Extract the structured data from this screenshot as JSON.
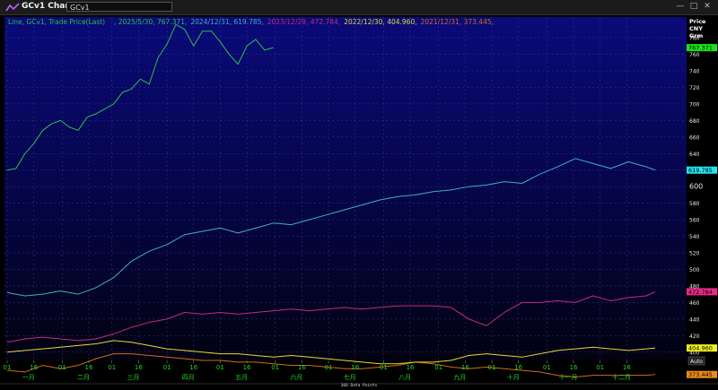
{
  "window": {
    "title": "GCv1 Chart",
    "ticker": "GCv1",
    "controls": [
      "—",
      "□",
      "✕"
    ]
  },
  "chart_data": {
    "type": "line",
    "title": "Line, GCv1, Trade Price(Last)",
    "y_axis_header": [
      "Price",
      "CNY",
      "Grm"
    ],
    "ylim": [
      390,
      805
    ],
    "yticks": [
      400,
      420,
      440,
      460,
      480,
      500,
      520,
      540,
      560,
      580,
      600,
      620,
      640,
      660,
      680,
      700,
      720,
      740,
      760,
      780
    ],
    "x_ticks": [
      "01",
      "16",
      "01",
      "16",
      "01",
      "16",
      "01",
      "16",
      "01",
      "16",
      "01",
      "16",
      "01",
      "16",
      "01",
      "16",
      "01",
      "16",
      "01",
      "16",
      "01",
      "16",
      "01",
      "16"
    ],
    "months": [
      "一月",
      "二月",
      "三月",
      "四月",
      "五月",
      "六月",
      "七月",
      "八月",
      "九月",
      "十月",
      "十一月",
      "十二月"
    ],
    "footer": "366 Data Points",
    "auto_label": "Auto",
    "series": [
      {
        "name": "2025/5/30",
        "last_label": "767.371",
        "color": "#2dbf4a",
        "badge_color": "#19e619",
        "x": [
          0,
          5,
          10,
          15,
          20,
          25,
          30,
          35,
          40,
          45,
          50,
          55,
          60,
          65,
          70,
          75,
          80,
          85,
          90,
          95,
          100,
          105,
          110,
          115,
          120,
          125,
          130,
          135,
          140,
          145,
          150
        ],
        "values": [
          620,
          622,
          640,
          652,
          668,
          676,
          680,
          672,
          668,
          684,
          688,
          694,
          700,
          714,
          718,
          730,
          724,
          756,
          772,
          796,
          790,
          770,
          788,
          788,
          775,
          760,
          748,
          770,
          778,
          765,
          768
        ]
      },
      {
        "name": "2024/12/31",
        "last_label": "619.785",
        "color": "#3db0bf",
        "badge_color": "#22e5f0",
        "x": [
          0,
          10,
          20,
          30,
          40,
          50,
          60,
          70,
          80,
          90,
          100,
          110,
          120,
          130,
          140,
          150,
          160,
          170,
          180,
          190,
          200,
          210,
          220,
          230,
          240,
          250,
          260,
          270,
          280,
          290,
          300,
          310,
          320,
          330,
          340,
          350,
          360,
          365
        ],
        "values": [
          472,
          468,
          470,
          474,
          470,
          478,
          490,
          510,
          522,
          530,
          542,
          546,
          550,
          544,
          550,
          556,
          554,
          560,
          566,
          572,
          578,
          584,
          588,
          590,
          594,
          596,
          600,
          602,
          606,
          604,
          615,
          624,
          634,
          628,
          622,
          630,
          624,
          620
        ]
      },
      {
        "name": "2023/12/29",
        "last_label": "472.784",
        "color": "#c82a78",
        "badge_color": "#ea2a8a",
        "x": [
          0,
          10,
          20,
          30,
          40,
          50,
          60,
          70,
          80,
          90,
          100,
          110,
          120,
          130,
          140,
          150,
          160,
          170,
          180,
          190,
          200,
          210,
          220,
          230,
          240,
          250,
          260,
          270,
          280,
          290,
          300,
          310,
          320,
          330,
          340,
          350,
          360,
          365
        ],
        "values": [
          412,
          416,
          418,
          416,
          414,
          416,
          422,
          430,
          436,
          440,
          448,
          446,
          448,
          446,
          448,
          450,
          452,
          450,
          452,
          454,
          452,
          454,
          456,
          456,
          456,
          454,
          440,
          432,
          448,
          460,
          460,
          462,
          460,
          468,
          462,
          466,
          468,
          473
        ]
      },
      {
        "name": "2022/12/30",
        "last_label": "404.960",
        "color": "#e6d836",
        "badge_color": "#f0f020",
        "x": [
          0,
          10,
          20,
          30,
          40,
          50,
          60,
          70,
          80,
          90,
          100,
          110,
          120,
          130,
          140,
          150,
          160,
          170,
          180,
          190,
          200,
          210,
          220,
          230,
          240,
          250,
          260,
          270,
          280,
          290,
          300,
          310,
          320,
          330,
          340,
          350,
          360,
          365
        ],
        "values": [
          400,
          402,
          404,
          406,
          408,
          410,
          414,
          412,
          408,
          404,
          402,
          400,
          398,
          398,
          396,
          394,
          396,
          394,
          392,
          390,
          388,
          386,
          386,
          388,
          388,
          390,
          396,
          398,
          396,
          394,
          398,
          402,
          404,
          406,
          404,
          402,
          404,
          405
        ]
      },
      {
        "name": "2021/12/31",
        "last_label": "373.445",
        "color": "#d06a1e",
        "badge_color": "#ee8a18",
        "x": [
          0,
          10,
          20,
          30,
          40,
          50,
          60,
          70,
          80,
          90,
          100,
          110,
          120,
          130,
          140,
          150,
          160,
          170,
          180,
          190,
          200,
          210,
          220,
          230,
          240,
          250,
          260,
          270,
          280,
          290,
          300,
          310,
          320,
          330,
          340,
          350,
          360,
          365
        ],
        "values": [
          378,
          376,
          384,
          380,
          384,
          392,
          398,
          398,
          396,
          394,
          392,
          390,
          390,
          388,
          388,
          386,
          384,
          384,
          382,
          380,
          380,
          382,
          384,
          388,
          386,
          382,
          380,
          382,
          380,
          378,
          376,
          372,
          370,
          372,
          372,
          372,
          372,
          373
        ]
      }
    ]
  }
}
